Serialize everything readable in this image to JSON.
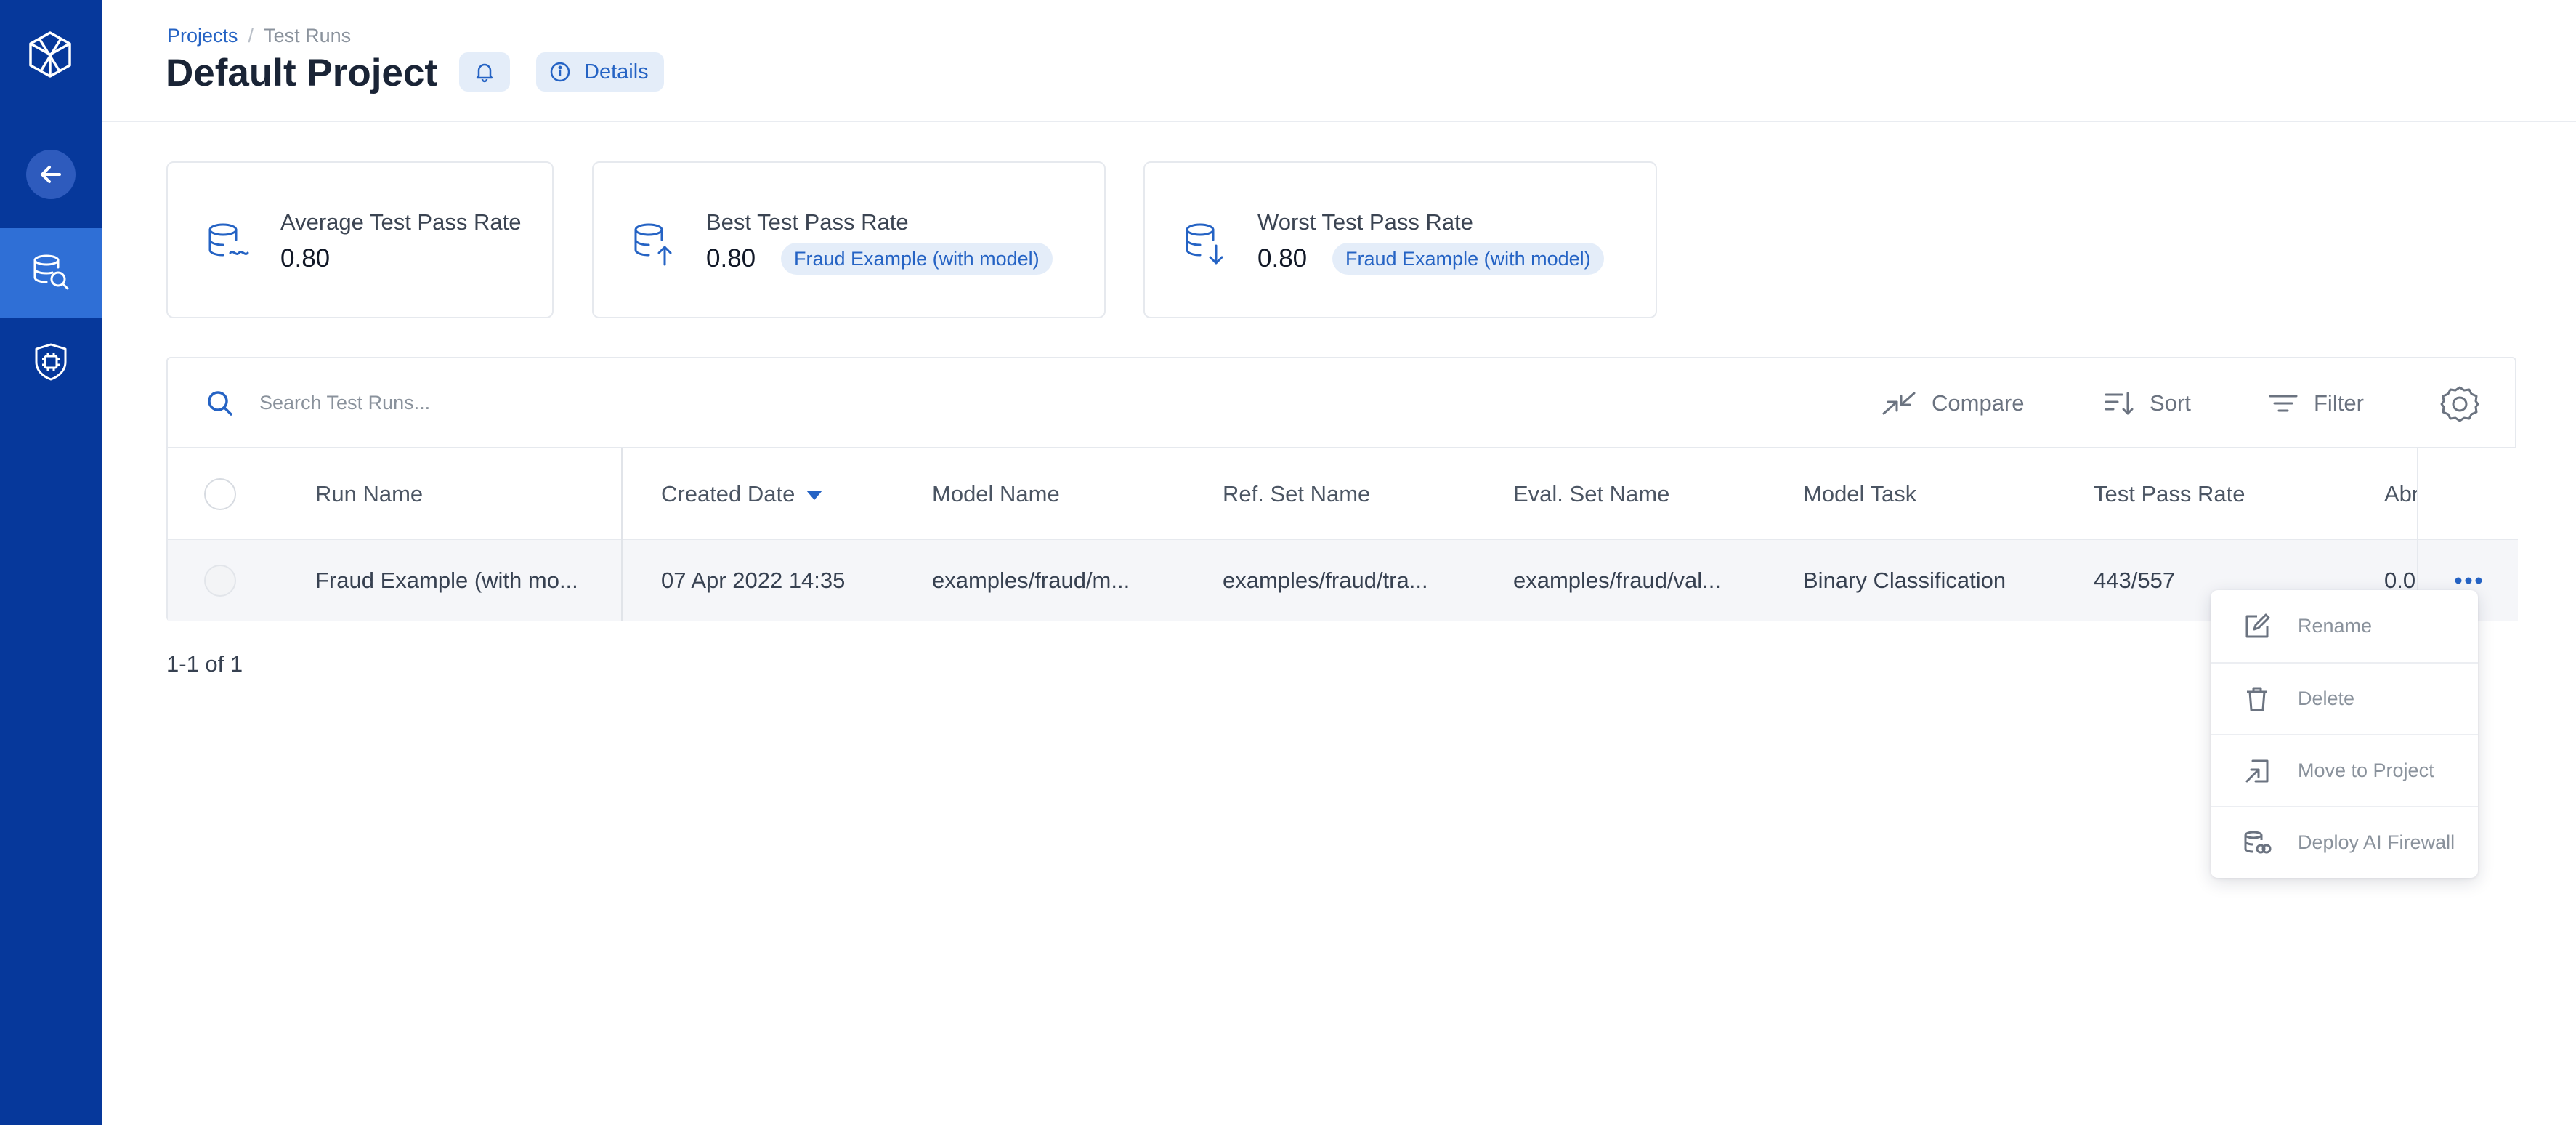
{
  "breadcrumb": {
    "root": "Projects",
    "current": "Test Runs"
  },
  "header": {
    "title": "Default Project",
    "details_label": "Details"
  },
  "stats": [
    {
      "title": "Average Test Pass Rate",
      "value": "0.80"
    },
    {
      "title": "Best Test Pass Rate",
      "value": "0.80",
      "tag": "Fraud Example (with model)"
    },
    {
      "title": "Worst Test Pass Rate",
      "value": "0.80",
      "tag": "Fraud Example (with model)"
    }
  ],
  "toolbar": {
    "search_placeholder": "Search Test Runs...",
    "compare_label": "Compare",
    "sort_label": "Sort",
    "filter_label": "Filter"
  },
  "table": {
    "columns": [
      "Run Name",
      "Created Date",
      "Model Name",
      "Ref. Set Name",
      "Eval. Set Name",
      "Model Task",
      "Test Pass Rate",
      "Abr"
    ],
    "rows": [
      {
        "run_name": "Fraud Example (with mo...",
        "created_date": "07 Apr 2022 14:35",
        "model_name": "examples/fraud/m...",
        "ref_set": "examples/fraud/tra...",
        "eval_set": "examples/fraud/val...",
        "model_task": "Binary Classification",
        "pass_rate": "443/557",
        "abr": "0.0"
      }
    ]
  },
  "pagination": {
    "label": "1-1 of 1"
  },
  "menu": {
    "items": [
      "Rename",
      "Delete",
      "Move to Project",
      "Deploy AI Firewall"
    ]
  },
  "colors": {
    "sidebar": "#06389b",
    "sidebar_active": "#2f6fd6",
    "accent": "#2563c4",
    "tag_bg": "#e4edf9"
  }
}
